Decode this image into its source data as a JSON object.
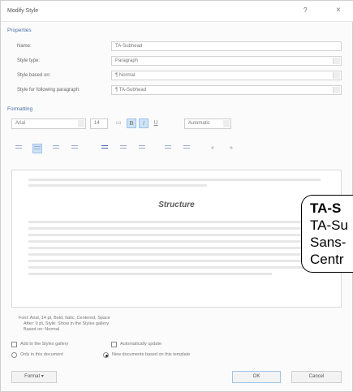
{
  "dialog": {
    "title": "Modify Style",
    "help_glyph": "?",
    "close_glyph": "×"
  },
  "properties": {
    "section_label": "Properties",
    "rows": [
      {
        "label": "Name:",
        "value": "TA-Subhead"
      },
      {
        "label": "Style type:",
        "value": "Paragraph"
      },
      {
        "label": "Style based on:",
        "value": "¶ Normal"
      },
      {
        "label": "Style for following paragraph:",
        "value": "¶ TA-Subhead"
      }
    ]
  },
  "formatting": {
    "section_label": "Formatting",
    "font": "Arial",
    "size": "14",
    "bold": "B",
    "italic": "I",
    "underline": "U",
    "color": "Automatic"
  },
  "preview": {
    "sample_text": "Structure"
  },
  "description": {
    "line1": "Font: Arial, 14 pt, Bold, Italic, Centered, Space",
    "line2": "After: 0 pt, Style: Show in the Styles gallery",
    "line3": "Based on: Normal"
  },
  "options": {
    "add_to_gallery": "Add to the Styles gallery",
    "auto_update": "Automatically update",
    "only_this_document": "Only in this document",
    "new_documents": "New documents based on this template"
  },
  "buttons": {
    "format": "Format ▾",
    "ok": "OK",
    "cancel": "Cancel"
  },
  "callout": {
    "line1": "TA-S",
    "line2": "TA-Su",
    "line3": "Sans-",
    "line4": "Centr"
  }
}
